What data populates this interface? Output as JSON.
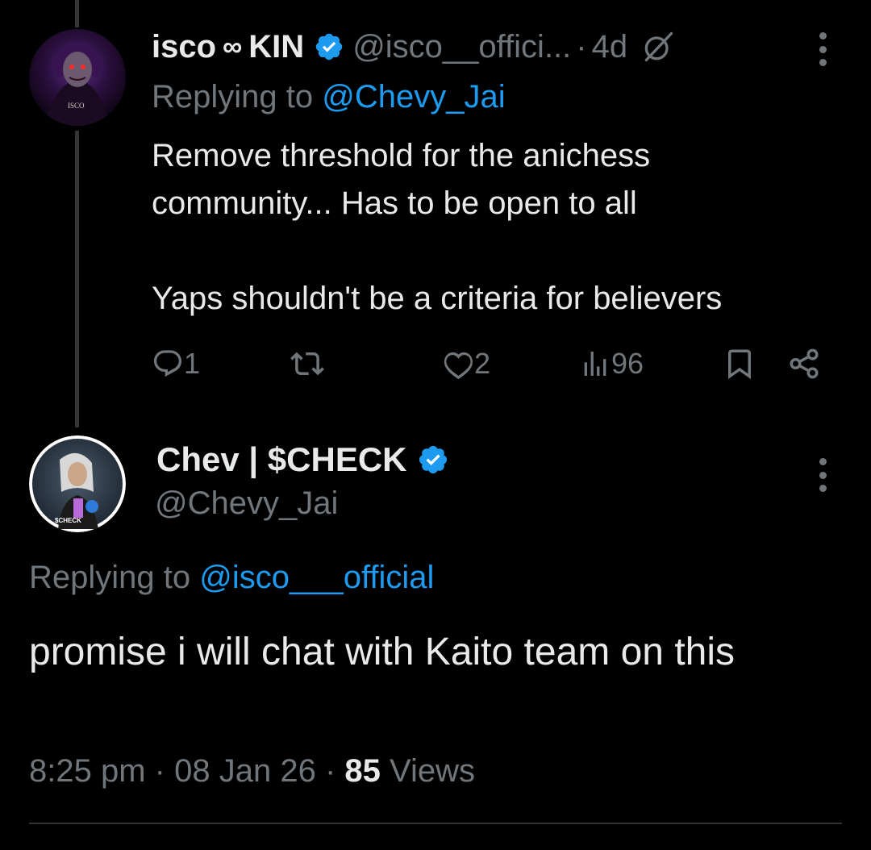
{
  "colors": {
    "background": "#000000",
    "primary_text": "#e7e9ea",
    "secondary_text": "#71767b",
    "link": "#1d9bf0",
    "verified_badge": "#1d9bf0",
    "divider": "#2f3336"
  },
  "parent_tweet": {
    "display_name": "isco",
    "name_symbol": "∞",
    "name_suffix": "KIN",
    "verified_icon": "verified-badge-icon",
    "handle": "@isco__offici...",
    "separator": "·",
    "time": "4d",
    "grok_icon": "grok-icon",
    "more_icon": "more-vertical-icon",
    "replying_prefix": "Replying to",
    "replying_handle": "@Chevy_Jai",
    "text_line1": "Remove threshold for the anichess",
    "text_line2": "community... Has to be open to all",
    "text_line3": "Yaps shouldn't be a criteria for believers",
    "actions": {
      "reply_icon": "reply-icon",
      "reply_count": "1",
      "retweet_icon": "retweet-icon",
      "like_icon": "heart-icon",
      "like_count": "2",
      "views_icon": "views-chart-icon",
      "views_count": "96",
      "bookmark_icon": "bookmark-icon",
      "share_icon": "share-icon"
    }
  },
  "reply_tweet": {
    "display_name": "Chev | $CHECK",
    "verified_icon": "verified-badge-icon",
    "handle": "@Chevy_Jai",
    "more_icon": "more-vertical-icon",
    "replying_prefix": "Replying to",
    "replying_handle": "@isco___official",
    "text": "promise i will chat with Kaito team on this",
    "time": "8:25 pm",
    "separator": "·",
    "date": "08 Jan 26",
    "views_count": "85",
    "views_label": "Views"
  }
}
